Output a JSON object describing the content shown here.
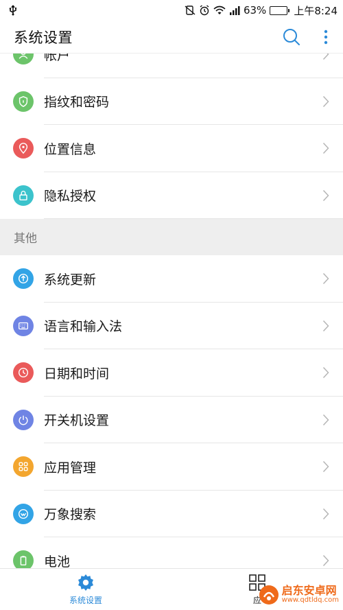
{
  "status_bar": {
    "battery_percent_text": "63%",
    "battery_level": 0.63,
    "time": "上午8:24",
    "icons": [
      "usb-icon",
      "mute-icon",
      "alarm-icon",
      "wifi-icon",
      "signal-icon",
      "battery-icon"
    ]
  },
  "app_bar": {
    "title": "系统设置",
    "icons": [
      "search-icon",
      "more-vert-icon"
    ]
  },
  "sections": [
    {
      "items": [
        {
          "label": "帐户",
          "icon": "account-icon",
          "color": "#6cc46a"
        },
        {
          "label": "指纹和密码",
          "icon": "shield-icon",
          "color": "#6cc46a"
        },
        {
          "label": "位置信息",
          "icon": "location-icon",
          "color": "#ea5a5a"
        },
        {
          "label": "隐私授权",
          "icon": "lock-icon",
          "color": "#3cc3cc"
        }
      ]
    },
    {
      "header": "其他",
      "items": [
        {
          "label": "系统更新",
          "icon": "update-icon",
          "color": "#32a4e6"
        },
        {
          "label": "语言和输入法",
          "icon": "keyboard-icon",
          "color": "#6f84e4"
        },
        {
          "label": "日期和时间",
          "icon": "clock-icon",
          "color": "#ea5a5a"
        },
        {
          "label": "开关机设置",
          "icon": "power-icon",
          "color": "#6f84e4"
        },
        {
          "label": "应用管理",
          "icon": "apps-icon",
          "color": "#f3a62f"
        },
        {
          "label": "万象搜索",
          "icon": "search-icon",
          "color": "#32a4e6"
        },
        {
          "label": "电池",
          "icon": "battery-icon",
          "color": "#6cc46a"
        }
      ]
    }
  ],
  "bottom_nav": {
    "tabs": [
      {
        "label": "系统设置",
        "icon": "gear-icon",
        "active": true
      },
      {
        "label": "应",
        "icon": "apps-grid-icon",
        "active": false
      }
    ]
  },
  "watermark": {
    "title": "启东安卓网",
    "url": "www.qdtldq.com"
  },
  "colors": {
    "accent": "#2b8ad8",
    "section_bg": "#eeeeee"
  }
}
